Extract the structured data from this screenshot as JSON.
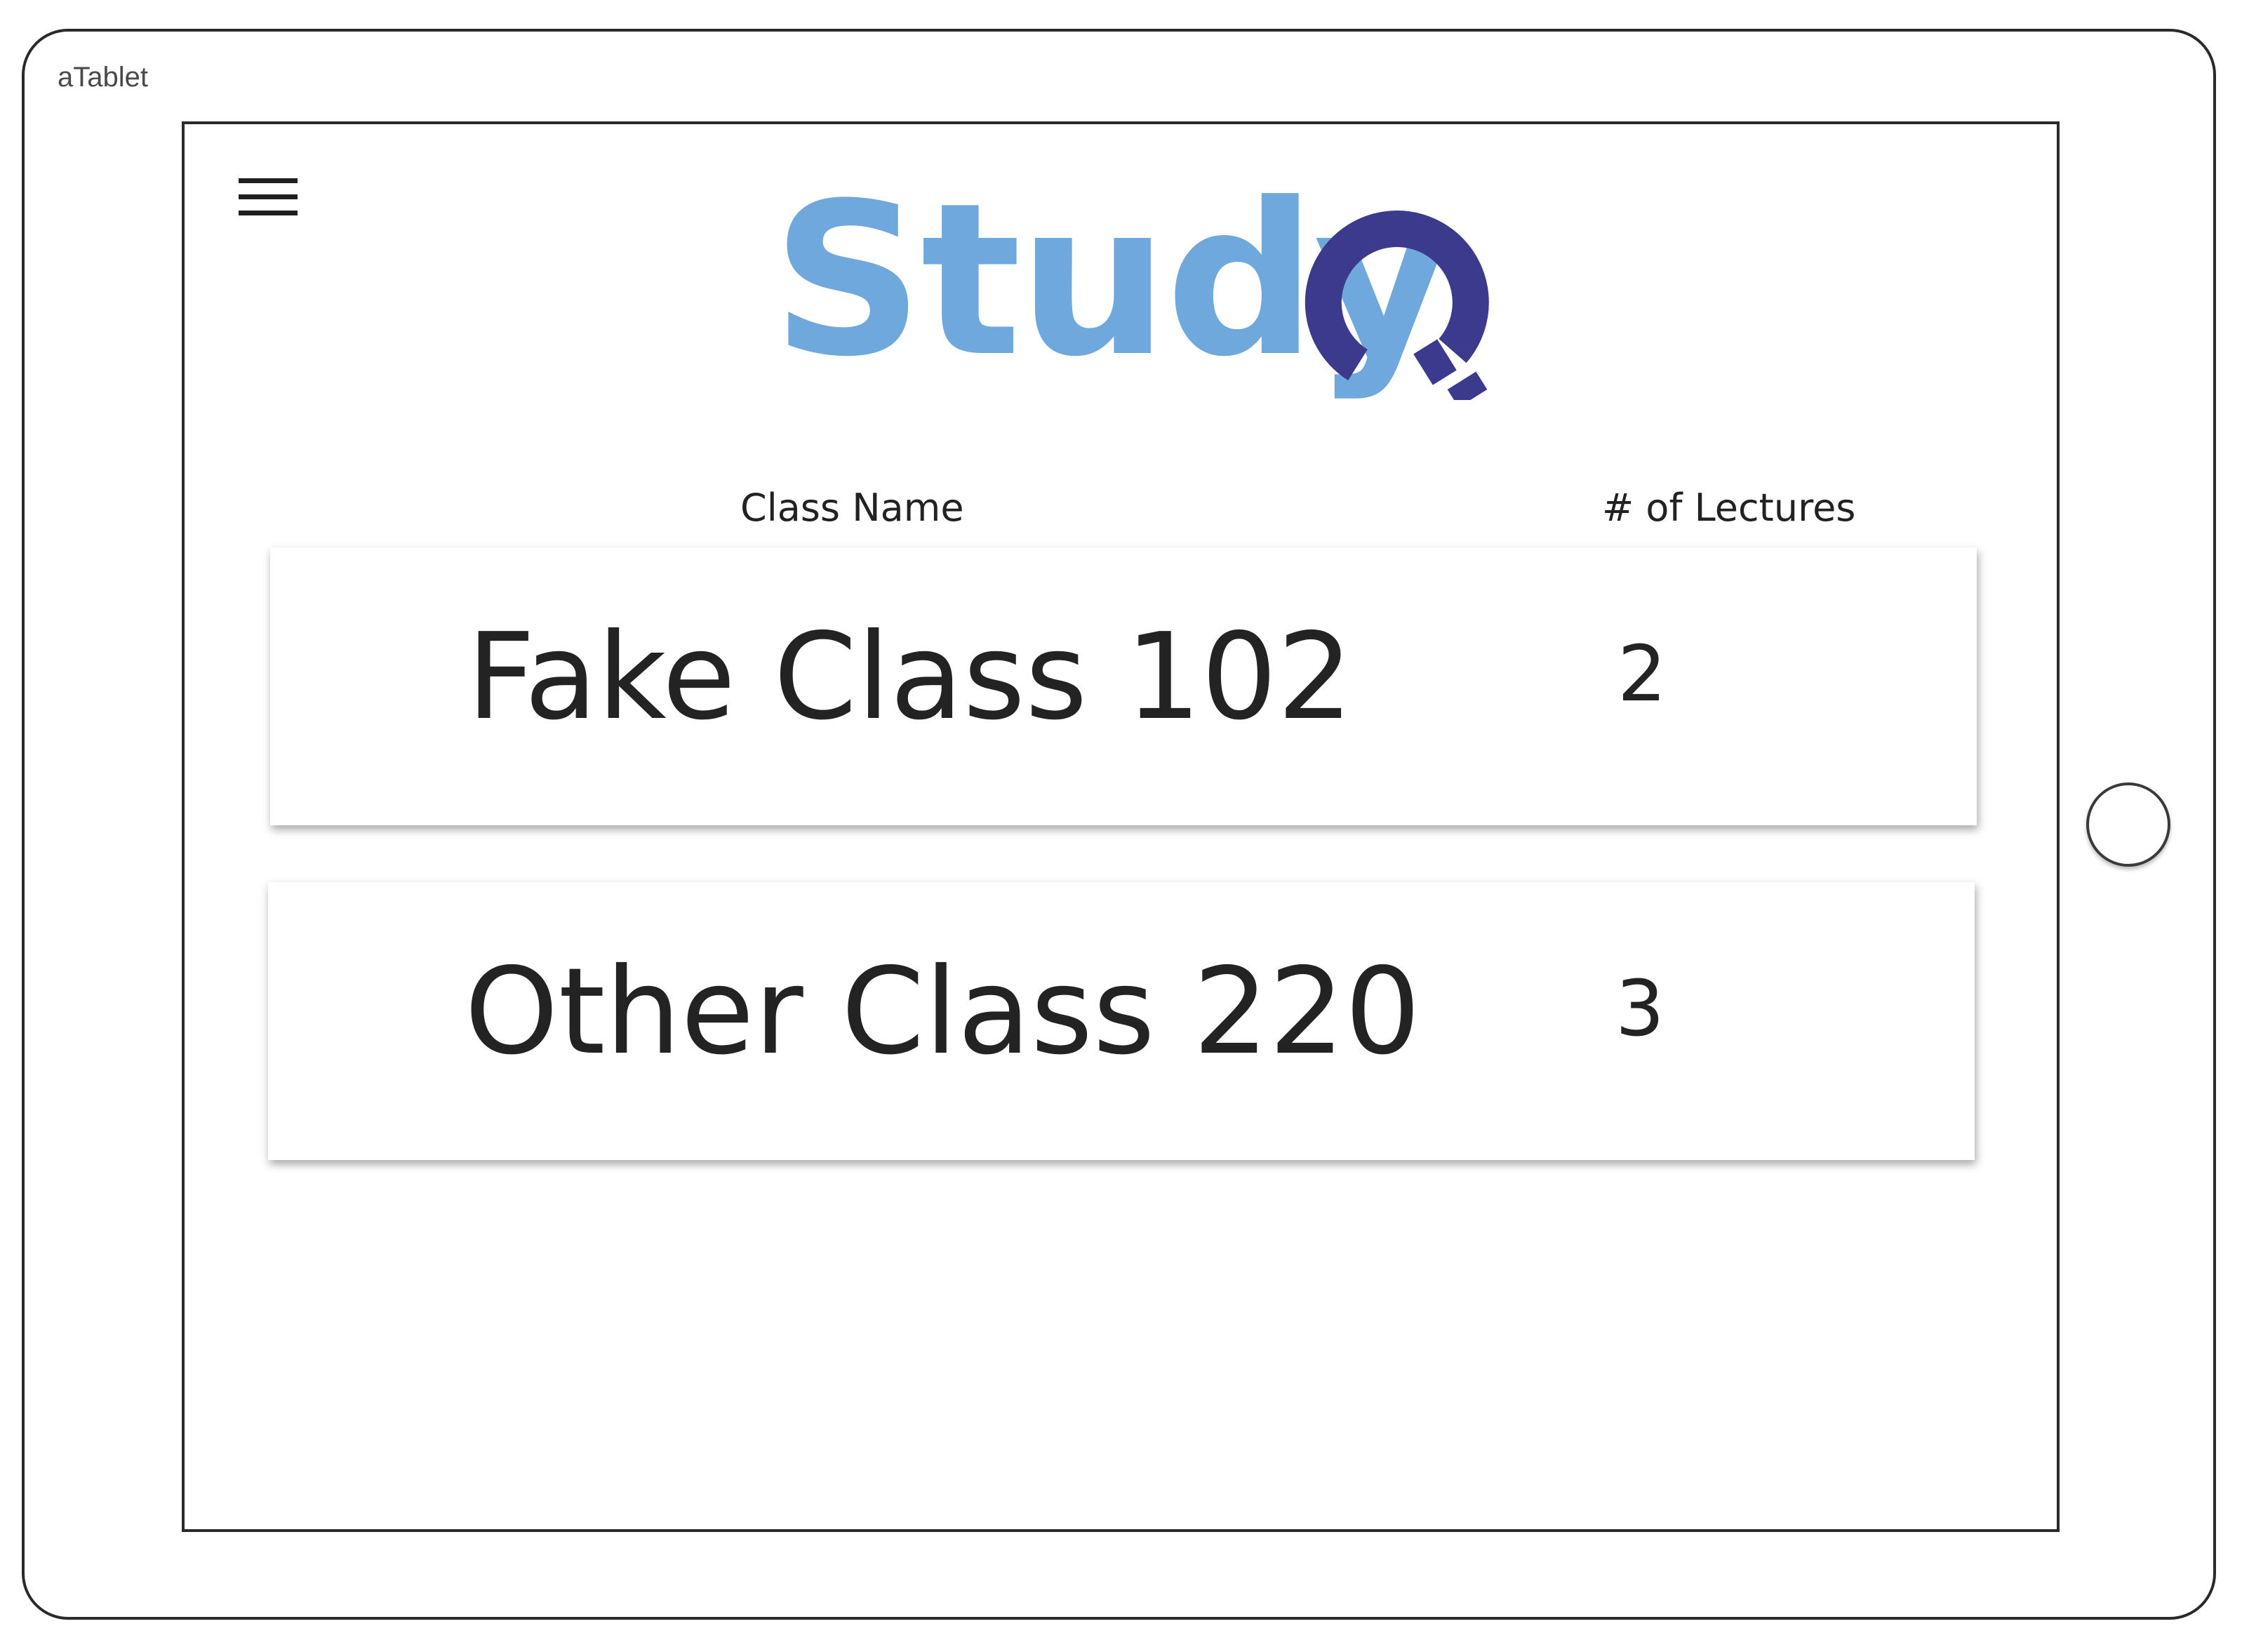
{
  "device": {
    "label": "aTablet"
  },
  "header": {
    "menu_icon": "hamburger-menu-icon",
    "logo_text": "Study",
    "logo_q_icon": "magnifier-q-icon",
    "colors": {
      "logo_text": "#6fa8dc",
      "logo_q": "#3b3a8c"
    }
  },
  "table": {
    "columns": {
      "class_name": "Class Name",
      "lectures": "# of Lectures"
    },
    "rows": [
      {
        "name": "Fake Class 102",
        "lectures": "2"
      },
      {
        "name": "Other Class 220",
        "lectures": "3"
      }
    ]
  }
}
